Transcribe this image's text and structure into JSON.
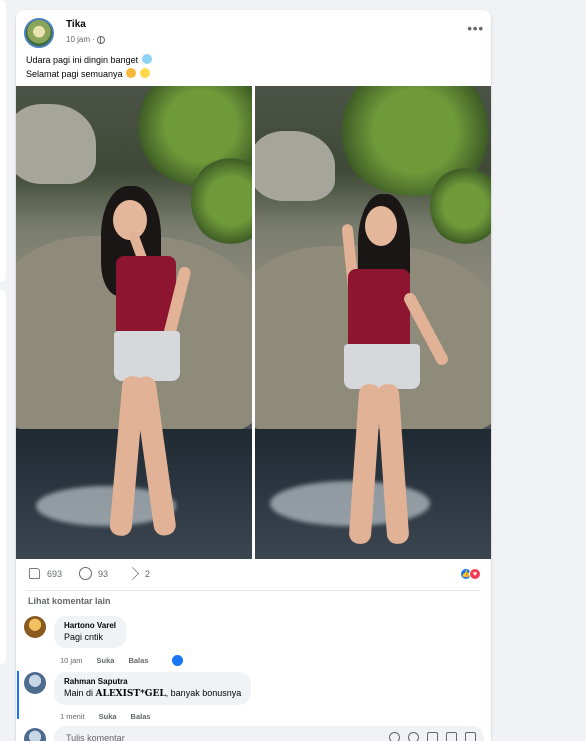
{
  "post": {
    "author": "Tika",
    "time": "10 jam",
    "separator": "·",
    "privacy_icon": "globe-icon",
    "more_label": "•••",
    "text_line1": "Udara pagi ini dingin banget",
    "text_line2": "Selamat pagi semuanya",
    "photos": [
      {
        "alt": "Woman posing on rock by stream, photo 1"
      },
      {
        "alt": "Woman posing on rock by stream, photo 2"
      }
    ]
  },
  "stats": {
    "likes": "693",
    "comments": "93",
    "shares": "2",
    "reaction_icons": [
      "like-icon",
      "love-icon"
    ]
  },
  "comments_section": {
    "view_more": "Lihat komentar lain",
    "items": [
      {
        "name": "Hartono Varel",
        "text": "Pagi cntik",
        "time": "10 jam",
        "like_label": "Suka",
        "reply_label": "Balas"
      },
      {
        "name": "Rahman Saputra",
        "text_prefix": "Main di ",
        "text_brand": "ALEXIST*GEL",
        "text_suffix": ", banyak bonusnya",
        "time": "1 menit",
        "like_label": "Suka",
        "reply_label": "Balas"
      }
    ],
    "write_placeholder": "Tulis komentar"
  },
  "colors": {
    "accent": "#1877f2",
    "love": "#f33e58",
    "background": "#f0f2f5",
    "top_red": "#8e1530"
  }
}
